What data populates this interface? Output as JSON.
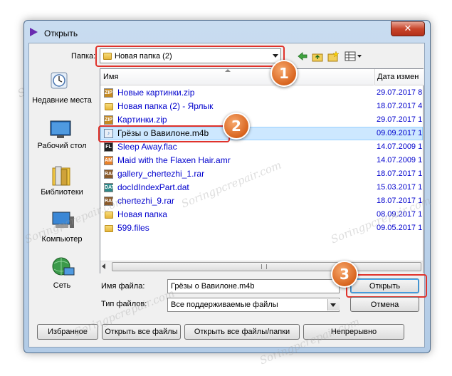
{
  "window": {
    "title": "Открыть",
    "close_label": "✕"
  },
  "location": {
    "label": "Папка:",
    "value": "Новая папка (2)"
  },
  "places": [
    {
      "label": "Недавние места",
      "icon": "recent-places-icon"
    },
    {
      "label": "Рабочий стол",
      "icon": "desktop-icon"
    },
    {
      "label": "Библиотеки",
      "icon": "libraries-icon"
    },
    {
      "label": "Компьютер",
      "icon": "computer-icon"
    },
    {
      "label": "Сеть",
      "icon": "network-icon"
    }
  ],
  "columns": {
    "name": "Имя",
    "date": "Дата измен"
  },
  "files": [
    {
      "name": "Новые картинки.zip",
      "date": "29.07.2017 8",
      "type": "zip"
    },
    {
      "name": "Новая папка (2) - Ярлык",
      "date": "18.07.2017 4",
      "type": "shortcut"
    },
    {
      "name": "Картинки.zip",
      "date": "29.07.2017 1",
      "type": "zip"
    },
    {
      "name": "Грёзы о Вавилоне.m4b",
      "date": "09.09.2017 1",
      "type": "m4b"
    },
    {
      "name": "Sleep Away.flac",
      "date": "14.07.2009 1",
      "type": "flac"
    },
    {
      "name": "Maid with the Flaxen Hair.amr",
      "date": "14.07.2009 1",
      "type": "amr"
    },
    {
      "name": "gallery_chertezhi_1.rar",
      "date": "18.07.2017 1",
      "type": "rar"
    },
    {
      "name": "docIdIndexPart.dat",
      "date": "15.03.2017 1",
      "type": "dat"
    },
    {
      "name": "chertezhi_9.rar",
      "date": "18.07.2017 1",
      "type": "rar"
    },
    {
      "name": "Новая папка",
      "date": "08.09.2017 1",
      "type": "folder"
    },
    {
      "name": "599.files",
      "date": "09.05.2017 1",
      "type": "folder"
    }
  ],
  "filename": {
    "label": "Имя файла:",
    "value": "Грёзы о Вавилоне.m4b"
  },
  "filetype": {
    "label": "Тип файлов:",
    "value": "Все поддерживаемые файлы"
  },
  "buttons": {
    "open": "Открыть",
    "cancel": "Отмена",
    "favorites": "Избранное",
    "open_all_files": "Открыть все файлы",
    "open_all_files_folders": "Открыть все файлы/папки",
    "continuous": "Непрерывно"
  },
  "callouts": [
    "1",
    "2",
    "3"
  ],
  "watermark": "Soringpcrepair.com",
  "colors": {
    "accent_callout": "#d8641e",
    "highlight_border": "#e0322b",
    "file_link": "#0000cd"
  }
}
